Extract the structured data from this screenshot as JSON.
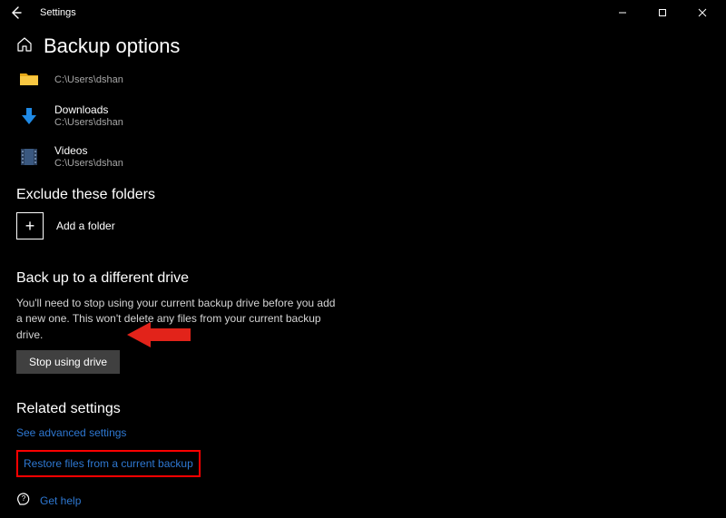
{
  "window": {
    "title": "Settings"
  },
  "page": {
    "heading": "Backup options"
  },
  "folders": [
    {
      "name": "",
      "path": "C:\\Users\\dshan"
    },
    {
      "name": "Downloads",
      "path": "C:\\Users\\dshan"
    },
    {
      "name": "Videos",
      "path": "C:\\Users\\dshan"
    }
  ],
  "exclude": {
    "heading": "Exclude these folders",
    "add_label": "Add a folder"
  },
  "different_drive": {
    "heading": "Back up to a different drive",
    "description": "You'll need to stop using your current backup drive before you add a new one. This won't delete any files from your current backup drive.",
    "button": "Stop using drive"
  },
  "related": {
    "heading": "Related settings",
    "advanced_link": "See advanced settings",
    "restore_link": "Restore files from a current backup"
  },
  "help": {
    "label": "Get help"
  }
}
